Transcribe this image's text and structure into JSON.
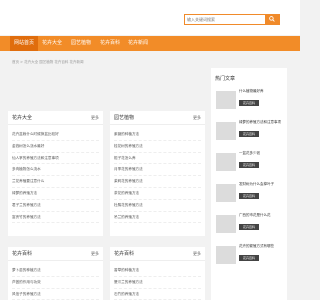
{
  "search": {
    "placeholder": "输入关键词搜索"
  },
  "nav": {
    "items": [
      "网站首页",
      "花卉大全",
      "园艺植物",
      "花卉百科",
      "花卉新闻"
    ]
  },
  "breadcrumb": "首页 > 花卉大全 园艺植物 花卉百科 花卉新闻",
  "panels": [
    {
      "title": "花卉大全",
      "more": "更多",
      "items": [
        "花卉盆栽什么时候换盆比较好",
        "金钱树怎么浇水最好",
        "仙人掌的养殖方法和注意事项",
        "多肉植物怎么浇水",
        "兰花养殖要注意什么",
        "绿萝的养殖方法",
        "君子兰的养殖方法",
        "富贵竹的养殖方法"
      ]
    },
    {
      "title": "园艺植物",
      "more": "更多",
      "items": [
        "紫薇的种植方法",
        "桂花树的养殖方法",
        "栀子花怎么养",
        "月季花的养殖方法",
        "茉莉花的养殖方法",
        "茶花的养殖方法",
        "杜鹃花的养殖方法",
        "吊兰的养殖方法"
      ]
    },
    {
      "title": "花卉百科",
      "more": "更多",
      "items": [
        "萝卜苗的种植方法",
        "芦荟的作用与功效",
        "风信子的养殖方法"
      ]
    },
    {
      "title": "花卉百科",
      "more": "更多",
      "items": [
        "香草的种植方法",
        "蟹爪兰的养殖方法",
        "石竹的养殖方法"
      ]
    }
  ],
  "hot": {
    "title": "热门文章",
    "items": [
      {
        "text": "什么植物最好养",
        "badge": "花卉百科"
      },
      {
        "text": "绿萝的养殖方法和注意事项",
        "badge": "花卉百科"
      },
      {
        "text": "一盆花多少钱",
        "badge": "花卉百科"
      },
      {
        "text": "发财树为什么会掉叶子",
        "badge": "花卉百科"
      },
      {
        "text": "广西的市花是什么花",
        "badge": "花卉百科"
      },
      {
        "text": "花卉的繁殖方式有哪些",
        "badge": "花卉百科"
      }
    ]
  }
}
